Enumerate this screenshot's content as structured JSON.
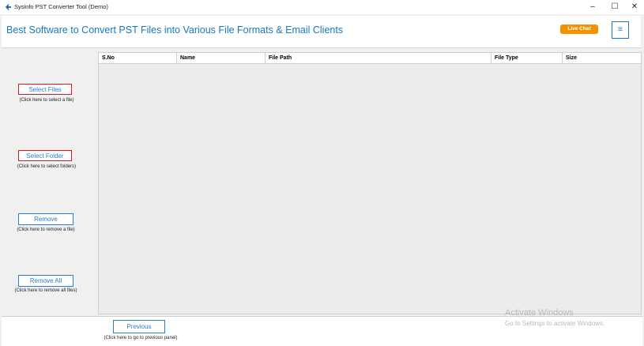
{
  "window": {
    "title": "Sysinfo PST Converter Tool (Demo)",
    "minimize": "–",
    "maximize": "☐",
    "close": "✕"
  },
  "header": {
    "tagline": "Best Software to Convert PST Files into Various File Formats & Email Clients",
    "live_chat": "Live Chat",
    "menu_icon": "≡"
  },
  "sidebar": {
    "select_files": {
      "label": "Select Files",
      "hint": "(Click here to select a file)"
    },
    "select_folder": {
      "label": "Select Folder",
      "hint": "(Click here to select folders)"
    },
    "remove": {
      "label": "Remove",
      "hint": "(Click here to remove a file)"
    },
    "remove_all": {
      "label": "Remove All",
      "hint": "(Click here to remove all files)"
    }
  },
  "table": {
    "columns": [
      "S.No",
      "Name",
      "File Path",
      "File Type",
      "Size"
    ]
  },
  "footer": {
    "previous": {
      "label": "Previous",
      "hint": "(Click here to go to previous panel)"
    }
  },
  "watermark": {
    "line1": "Activate Windows",
    "line2": "Go to Settings to activate Windows."
  },
  "colors": {
    "accent": "#1679bf",
    "highlight_border": "#d71920",
    "live_chat_bg": "#f39200"
  }
}
